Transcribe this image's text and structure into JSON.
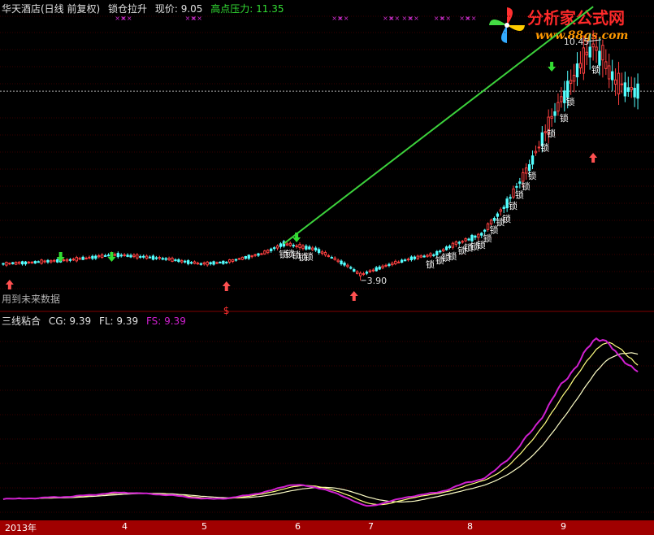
{
  "header": {
    "name": "华天酒店(日线 前复权)",
    "indicator": "锁仓拉升",
    "price_label": "现价: 9.05",
    "pressure_label": "高点压力: 11.35"
  },
  "sub_header": {
    "name": "三线粘合",
    "cg": "CG: 9.39",
    "fl": "FL: 9.39",
    "fs": "FS: 9.39"
  },
  "note": "用到未来数据",
  "logo": {
    "text": "分析家公式网",
    "url": "www.88gs.com"
  },
  "colors": {
    "bg": "#000000",
    "up": "#ff4040",
    "down": "#54ffff",
    "trend": "#3cd23c",
    "fs": "#d020d0",
    "cg": "#ffffc8",
    "fl": "#ffff80"
  },
  "chart_data": [
    {
      "type": "candlestick",
      "title": "华天酒店(日线 前复权)",
      "annotations": {
        "high_label": "10.45",
        "low_label": "3.90",
        "lock_label": "锁",
        "s_label": "$",
        "top_markers": "××"
      },
      "ylim": [
        3.3,
        11.0
      ],
      "reference_price": 9.05,
      "trend_line": {
        "from_index": 88,
        "from_price": 4.9,
        "to_index": 185,
        "to_price": 11.35
      }
    },
    {
      "type": "line",
      "title": "三线粘合",
      "series": [
        {
          "name": "CG",
          "color": "#ffffc8"
        },
        {
          "name": "FL",
          "color": "#ffff80"
        },
        {
          "name": "FS",
          "color": "#d020d0"
        }
      ],
      "last_values": {
        "CG": 9.39,
        "FL": 9.39,
        "FS": 9.39
      }
    }
  ],
  "date_axis": [
    "2013年",
    "4",
    "5",
    "6",
    "7",
    "8",
    "9"
  ]
}
